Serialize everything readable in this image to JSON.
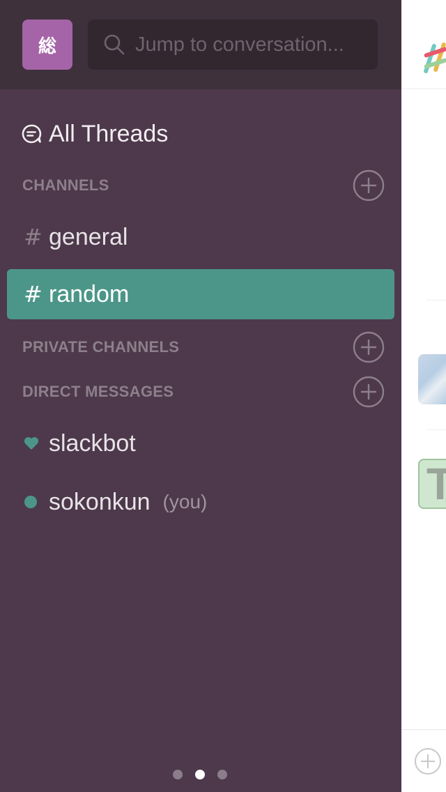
{
  "team": {
    "icon_label": "総"
  },
  "search": {
    "placeholder": "Jump to conversation..."
  },
  "all_threads": {
    "label": "All Threads"
  },
  "sections": {
    "channels": {
      "label": "CHANNELS"
    },
    "private_channels": {
      "label": "PRIVATE CHANNELS"
    },
    "direct_messages": {
      "label": "DIRECT MESSAGES"
    }
  },
  "channels": [
    {
      "prefix": "#",
      "name": "general",
      "active": false
    },
    {
      "prefix": "#",
      "name": "random",
      "active": true
    }
  ],
  "direct_messages": [
    {
      "name": "slackbot",
      "presence": "heart",
      "suffix": ""
    },
    {
      "name": "sokonkun",
      "presence": "online",
      "suffix": "(you)"
    }
  ],
  "pager": {
    "page_count": 3,
    "current_page": 2
  },
  "colors": {
    "sidebar_bg": "#4d394b",
    "header_bg": "#3e313c",
    "active_item": "#4c9689",
    "team_icon": "#a464a7",
    "presence_green": "#4c9689"
  }
}
